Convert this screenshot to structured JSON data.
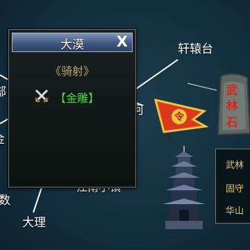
{
  "map": {
    "labels": {
      "xuanyuantai": "轩辕台",
      "dali": "大理",
      "partial_left_top": "部",
      "partial_left_mid": "金",
      "partial_left_low": "数",
      "partial_center": "江南小镇",
      "partial_popup_right": "河"
    }
  },
  "popup": {
    "title": "大漠",
    "close_label": "X",
    "subtitle": "《骑射》",
    "item": {
      "icon": "crossed-swords-icon",
      "label": "【金雕】"
    }
  },
  "flag": {
    "icon": "command-flag-icon",
    "text": "令"
  },
  "stone": {
    "text_1": "武",
    "text_2": "林",
    "text_3": "石"
  },
  "side_list": {
    "items": [
      "武林",
      "固守",
      "华山"
    ]
  },
  "colors": {
    "map_bg": "#14303f",
    "popup_header": "#41577e",
    "subtitle": "#b9a16c",
    "item_label": "#4fd04a",
    "stone_text": "#d8261b",
    "side_text": "#e6c56a"
  }
}
